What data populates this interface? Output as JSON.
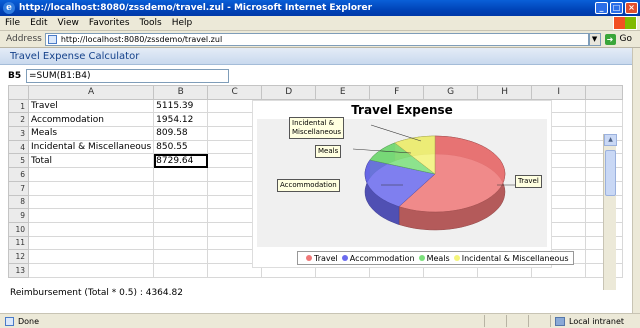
{
  "window": {
    "title": "http://localhost:8080/zssdemo/travel.zul - Microsoft Internet Explorer",
    "minimize": "_",
    "maximize": "□",
    "close": "×"
  },
  "menu": [
    "File",
    "Edit",
    "View",
    "Favorites",
    "Tools",
    "Help"
  ],
  "address": {
    "label": "Address",
    "url": "http://localhost:8080/zssdemo/travel.zul",
    "go": "Go"
  },
  "app": {
    "title": "Travel Expense Calculator",
    "cell_ref": "B5",
    "formula": "=SUM(B1:B4)",
    "columns": [
      "A",
      "B",
      "C",
      "D",
      "E",
      "F",
      "G",
      "H",
      "I"
    ],
    "rows": [
      {
        "num": "1",
        "a": "Travel",
        "b": "5115.39"
      },
      {
        "num": "2",
        "a": "Accommodation",
        "b": "1954.12"
      },
      {
        "num": "3",
        "a": "Meals",
        "b": "809.58"
      },
      {
        "num": "4",
        "a": "Incidental & Miscellaneous",
        "b": "850.55"
      },
      {
        "num": "5",
        "a": "Total",
        "b": "8729.64"
      },
      {
        "num": "6",
        "a": "",
        "b": ""
      },
      {
        "num": "7",
        "a": "",
        "b": ""
      },
      {
        "num": "8",
        "a": "",
        "b": ""
      },
      {
        "num": "9",
        "a": "",
        "b": ""
      },
      {
        "num": "10",
        "a": "",
        "b": ""
      },
      {
        "num": "11",
        "a": "",
        "b": ""
      },
      {
        "num": "12",
        "a": "",
        "b": ""
      },
      {
        "num": "13",
        "a": "",
        "b": ""
      }
    ],
    "reimbursement": "Reimbursement (Total * 0.5) : 4364.82"
  },
  "chart_data": {
    "type": "pie",
    "title": "Travel Expense",
    "categories": [
      "Travel",
      "Accommodation",
      "Meals",
      "Incidental & Miscellaneous"
    ],
    "values": [
      5115.39,
      1954.12,
      809.58,
      850.55
    ],
    "colors": [
      "#f07878",
      "#6b6bef",
      "#7be07b",
      "#f5f57a"
    ],
    "callouts": [
      "Travel",
      "Accommodation",
      "Meals",
      "Incidental &\nMiscellaneous"
    ],
    "legend_position": "bottom"
  },
  "status": {
    "text": "Done",
    "zone": "Local intranet"
  }
}
